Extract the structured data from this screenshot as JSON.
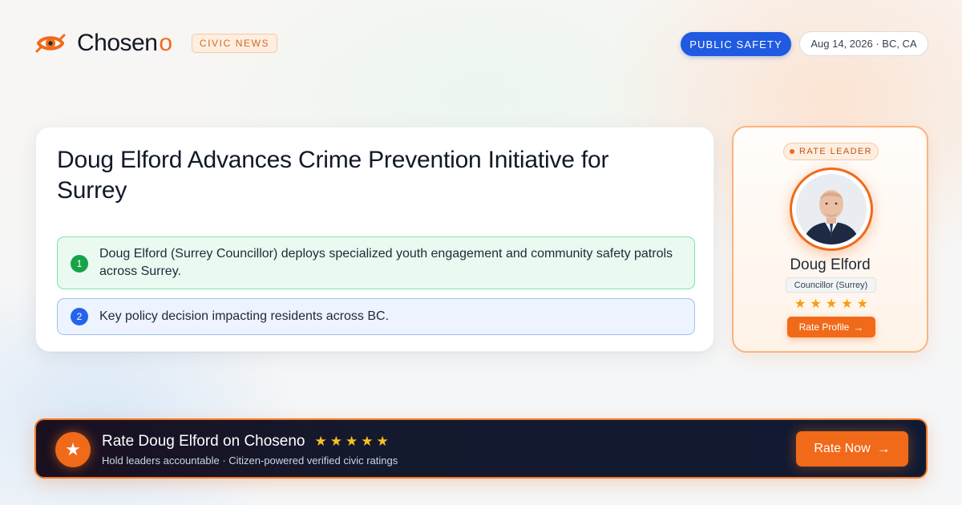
{
  "brand": {
    "name": "Chosen",
    "name_accent": "o",
    "logo_icon": "eye-logo-icon",
    "accent_color": "#f06a1a"
  },
  "header": {
    "category_tag": "CIVIC NEWS",
    "topic_pill": "PUBLIC SAFETY",
    "topic_color": "#1f5ae0",
    "dateline": "Aug 14, 2026 · BC, CA"
  },
  "article": {
    "headline": "Doug Elford Advances Crime Prevention Initiative for Surrey",
    "points": [
      {
        "number": "1",
        "text": "Doug Elford (Surrey Councillor) deploys specialized youth engagement and community safety patrols across Surrey.",
        "color": "#16a34a"
      },
      {
        "number": "2",
        "text": "Key policy decision impacting residents across BC.",
        "color": "#2563eb"
      }
    ]
  },
  "profile": {
    "badge": "RATE LEADER",
    "name": "Doug Elford",
    "role": "Councillor (Surrey)",
    "stars": "★★★★★",
    "rating_stars": 5,
    "button_label": "Rate Profile",
    "button_arrow": "→"
  },
  "banner": {
    "title": "Rate Doug Elford on Choseno",
    "stars": "★★★★★",
    "subtitle": "Hold leaders accountable · Citizen-powered verified civic ratings",
    "button_label": "Rate Now",
    "button_arrow": "→",
    "icon": "star-icon"
  }
}
